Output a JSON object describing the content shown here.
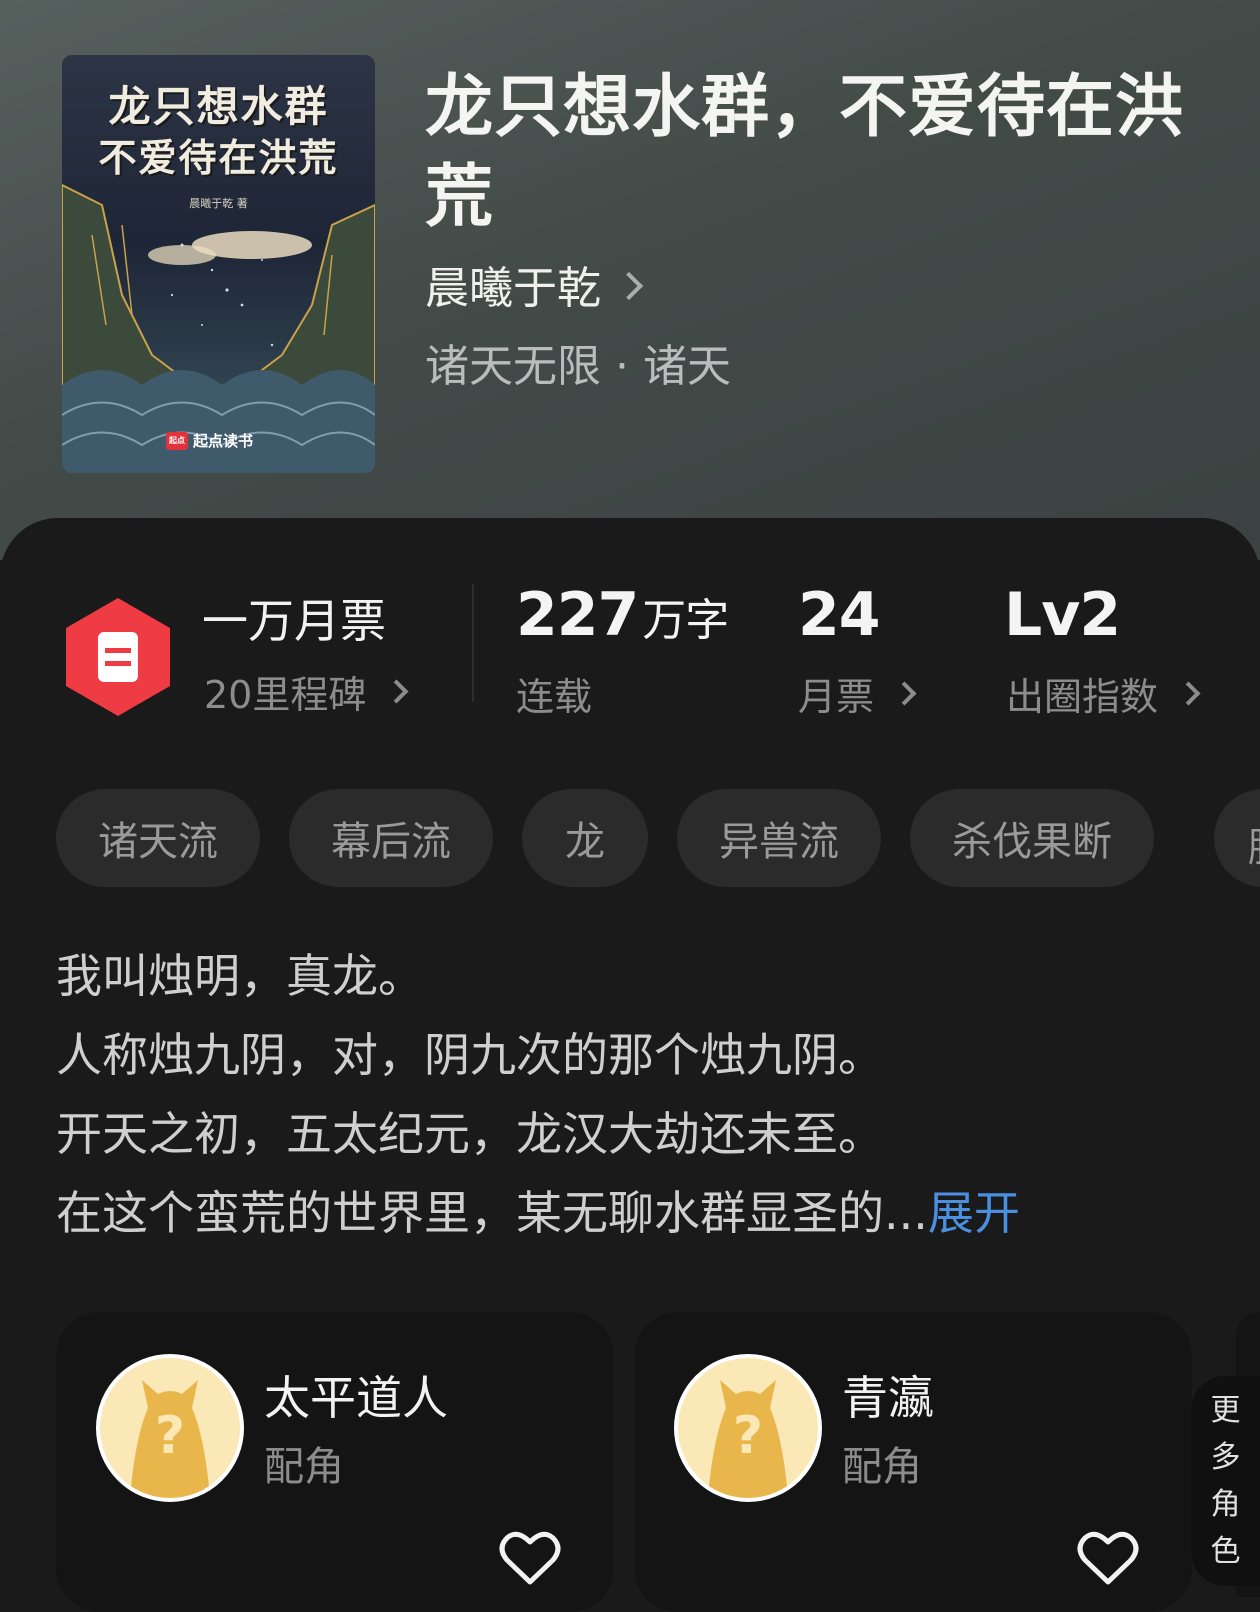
{
  "book": {
    "cover_title_line1": "龙只想水群",
    "cover_title_line2": "不爱待在洪荒",
    "cover_author": "晨曦于乾 著",
    "cover_brand": "起点读书",
    "cover_brand_logo": "起点",
    "title": "龙只想水群，不爱待在洪荒",
    "author": "晨曦于乾",
    "category": "诸天无限 · 诸天"
  },
  "stats": {
    "badge_title": "一万月票",
    "badge_sub": "20里程碑",
    "words_value": "227",
    "words_unit": "万字",
    "words_label": "连载",
    "tickets_value": "24",
    "tickets_label": "月票",
    "level_value": "Lv2",
    "level_label": "出圈指数"
  },
  "tags": [
    "诸天流",
    "幕后流",
    "龙",
    "异兽流",
    "杀伐果断",
    "脑"
  ],
  "intro": {
    "lines": [
      "我叫烛明，真龙。",
      "人称烛九阴，对，阴九次的那个烛九阴。",
      "开天之初，五太纪元，龙汉大劫还未至。",
      "在这个蛮荒的世界里，某无聊水群显圣的..."
    ],
    "expand_label": "展开"
  },
  "characters": [
    {
      "name": "太平道人",
      "role": "配角"
    },
    {
      "name": "青瀛",
      "role": "配角"
    }
  ],
  "more_characters": [
    "更",
    "多",
    "角",
    "色"
  ],
  "colors": {
    "accent_blue": "#4a8fe0",
    "badge_red": "#ef3b44",
    "avatar_gold": "#e9b64c"
  }
}
